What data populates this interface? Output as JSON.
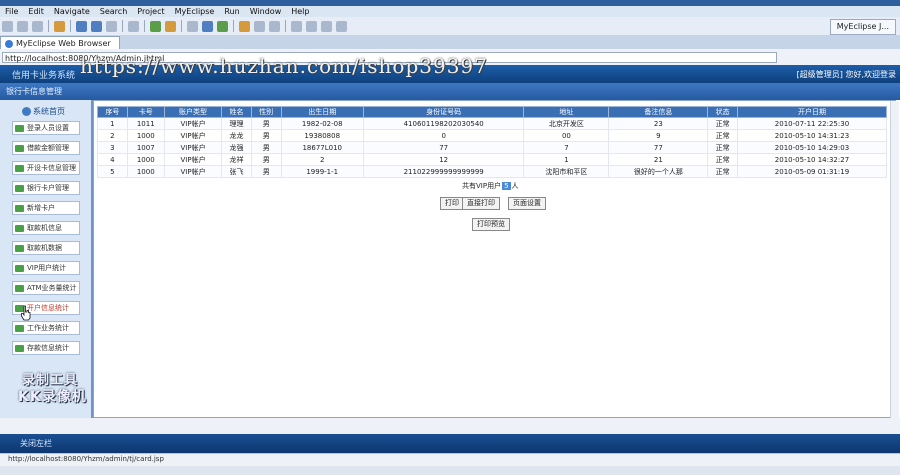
{
  "menu": [
    "File",
    "Edit",
    "Navigate",
    "Search",
    "Project",
    "MyEclipse",
    "Run",
    "Window",
    "Help"
  ],
  "perspective": "MyEclipse J...",
  "tab": {
    "label": "MyEclipse Web Browser"
  },
  "address": "http://localhost:8080/Yhzm/Admin.jhtml",
  "app": {
    "name": "信用卡业务系统",
    "user_info": "[超级管理员] 您好,欢迎登录",
    "page_title": "银行卡信息管理"
  },
  "watermark": "https://www.huzhan.com/ishop39397",
  "sidebar": {
    "top_label": "系统首页",
    "items": [
      {
        "label": "登录人员设置"
      },
      {
        "label": "借款金额管理"
      },
      {
        "label": "开设卡信息管理"
      },
      {
        "label": "银行卡户管理"
      },
      {
        "label": "新增卡户"
      },
      {
        "label": "取款机信息"
      },
      {
        "label": "取款机数据"
      },
      {
        "label": "VIP用户统计"
      },
      {
        "label": "ATM业务量统计"
      },
      {
        "label": "开户信息统计"
      },
      {
        "label": "工作业务统计"
      },
      {
        "label": "存款信息统计"
      }
    ]
  },
  "recorder": {
    "line1": "录制工具",
    "line2": "KK录像机"
  },
  "table": {
    "headers": [
      "序号",
      "卡号",
      "账户类型",
      "姓名",
      "性别",
      "出生日期",
      "身份证号码",
      "地址",
      "备注信息",
      "状态",
      "开户日期"
    ],
    "rows": [
      [
        "1",
        "1011",
        "VIP帐户",
        "理理",
        "男",
        "1982-02-08",
        "410601198202030540",
        "北京开发区",
        "23",
        "正常",
        "2010-07-11 22:25:30"
      ],
      [
        "2",
        "1000",
        "VIP帐户",
        "龙龙",
        "男",
        "19380808",
        "0",
        "00",
        "9",
        "正常",
        "2010-05-10 14:31:23"
      ],
      [
        "3",
        "1007",
        "VIP帐户",
        "龙强",
        "男",
        "18677L010",
        "77",
        "7",
        "77",
        "正常",
        "2010-05-10 14:29:03"
      ],
      [
        "4",
        "1000",
        "VIP帐户",
        "龙祥",
        "男",
        "2",
        "12",
        "1",
        "21",
        "正常",
        "2010-05-10 14:32:27"
      ],
      [
        "5",
        "1000",
        "VIP帐户",
        "张飞",
        "男",
        "1999-1-1",
        "211022999999999999",
        "沈阳市和平区",
        "很好的一个人那",
        "正常",
        "2010-05-09 01:31:19"
      ]
    ],
    "total_prefix": "共有VIP用户",
    "total_count": "5",
    "total_suffix": "人"
  },
  "buttons": {
    "print": "打印",
    "direct_print": "直接打印",
    "page_setup": "页面设置",
    "preview": "打印预览"
  },
  "footer": {
    "label": "关闭左栏"
  },
  "status": "http://localhost:8080/Yhzm/admin/tj/card.jsp"
}
